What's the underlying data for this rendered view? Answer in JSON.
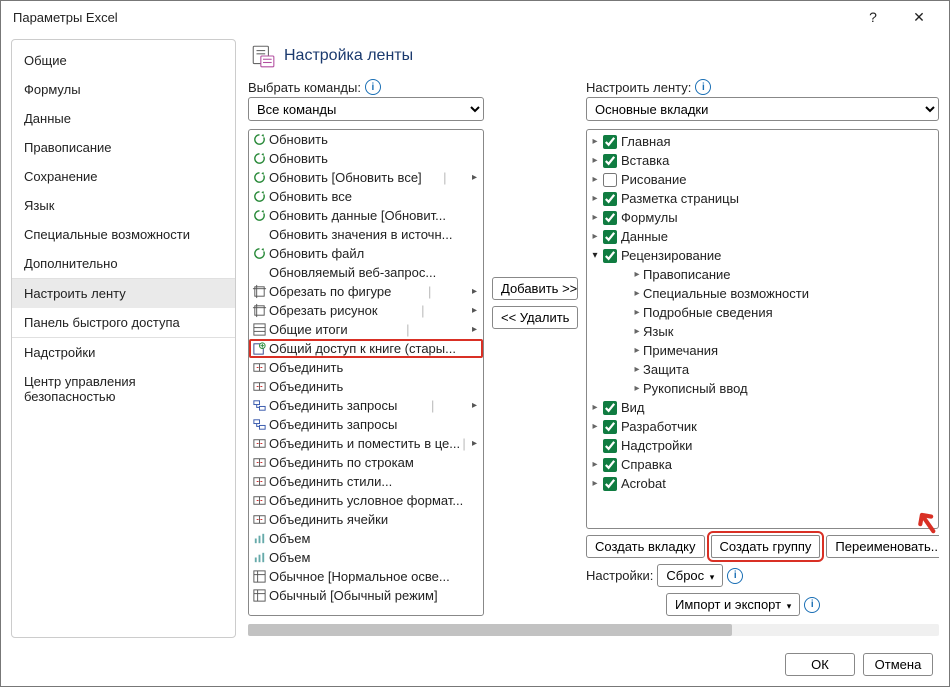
{
  "window": {
    "title": "Параметры Excel",
    "help_tooltip": "Справка",
    "close_tooltip": "Закрыть"
  },
  "sidebar": {
    "items": [
      "Общие",
      "Формулы",
      "Данные",
      "Правописание",
      "Сохранение",
      "Язык",
      "Специальные возможности",
      "Дополнительно"
    ],
    "items2": [
      "Настроить ленту",
      "Панель быстрого доступа"
    ],
    "items3": [
      "Надстройки",
      "Центр управления безопасностью"
    ],
    "selected": "Настроить ленту"
  },
  "header": {
    "title": "Настройка ленты"
  },
  "left": {
    "label": "Выбрать команды:",
    "dropdown": "Все команды"
  },
  "commands": [
    {
      "name": "Обновить",
      "icon": "refresh",
      "split": false
    },
    {
      "name": "Обновить",
      "icon": "refresh",
      "split": false
    },
    {
      "name": "Обновить [Обновить все]",
      "icon": "refresh-all",
      "split": true
    },
    {
      "name": "Обновить все",
      "icon": "refresh-all",
      "split": false
    },
    {
      "name": "Обновить данные [Обновит...",
      "icon": "refresh-data",
      "split": false
    },
    {
      "name": "Обновить значения в источн...",
      "icon": "blank",
      "split": false
    },
    {
      "name": "Обновить файл",
      "icon": "refresh-file",
      "split": false
    },
    {
      "name": "Обновляемый веб-запрос...",
      "icon": "blank",
      "split": false
    },
    {
      "name": "Обрезать по фигуре",
      "icon": "crop-shape",
      "split": true
    },
    {
      "name": "Обрезать рисунок",
      "icon": "crop",
      "split": true
    },
    {
      "name": "Общие итоги",
      "icon": "totals",
      "split": true
    },
    {
      "name": "Общий доступ к книге (стары...",
      "icon": "share",
      "split": false,
      "highlight": true
    },
    {
      "name": "Объединить",
      "icon": "merge",
      "split": false
    },
    {
      "name": "Объединить",
      "icon": "merge2",
      "split": false
    },
    {
      "name": "Объединить запросы",
      "icon": "merge-query",
      "split": true
    },
    {
      "name": "Объединить запросы",
      "icon": "merge-query",
      "split": false
    },
    {
      "name": "Объединить и поместить в це...",
      "icon": "merge-center",
      "split": true
    },
    {
      "name": "Объединить по строкам",
      "icon": "merge-rows",
      "split": false
    },
    {
      "name": "Объединить стили...",
      "icon": "merge-styles",
      "split": false
    },
    {
      "name": "Объединить условное формат...",
      "icon": "merge-cond",
      "split": false
    },
    {
      "name": "Объединить ячейки",
      "icon": "merge-cells",
      "split": false
    },
    {
      "name": "Объем",
      "icon": "volume",
      "split": false
    },
    {
      "name": "Объем",
      "icon": "volume2",
      "split": false
    },
    {
      "name": "Обычное [Нормальное осве...",
      "icon": "normal-light",
      "split": false
    },
    {
      "name": "Обычный [Обычный режим]",
      "icon": "normal",
      "split": false
    }
  ],
  "middle": {
    "add": "Добавить >>",
    "remove": "<< Удалить"
  },
  "right": {
    "label": "Настроить ленту:",
    "dropdown": "Основные вкладки"
  },
  "tree": {
    "top": [
      {
        "label": "Главная",
        "checked": true,
        "open": false
      },
      {
        "label": "Вставка",
        "checked": true,
        "open": false
      },
      {
        "label": "Рисование",
        "checked": false,
        "open": false
      },
      {
        "label": "Разметка страницы",
        "checked": true,
        "open": false
      },
      {
        "label": "Формулы",
        "checked": true,
        "open": false
      },
      {
        "label": "Данные",
        "checked": true,
        "open": false
      }
    ],
    "expanded": {
      "label": "Рецензирование",
      "checked": true,
      "children": [
        "Правописание",
        "Специальные возможности",
        "Подробные сведения",
        "Язык",
        "Примечания",
        "Защита",
        "Рукописный ввод"
      ]
    },
    "bottom": [
      {
        "label": "Вид",
        "checked": true,
        "open": false
      },
      {
        "label": "Разработчик",
        "checked": true,
        "open": false
      },
      {
        "label": "Надстройки",
        "checked": true,
        "nochev": true
      },
      {
        "label": "Справка",
        "checked": true,
        "open": false
      },
      {
        "label": "Acrobat",
        "checked": true,
        "open": false
      }
    ]
  },
  "below": {
    "new_tab": "Создать вкладку",
    "new_group": "Создать группу",
    "rename": "Переименовать...",
    "settings_label": "Настройки:",
    "reset": "Сброс",
    "import_export": "Импорт и экспорт"
  },
  "footer": {
    "ok": "ОК",
    "cancel": "Отмена"
  }
}
